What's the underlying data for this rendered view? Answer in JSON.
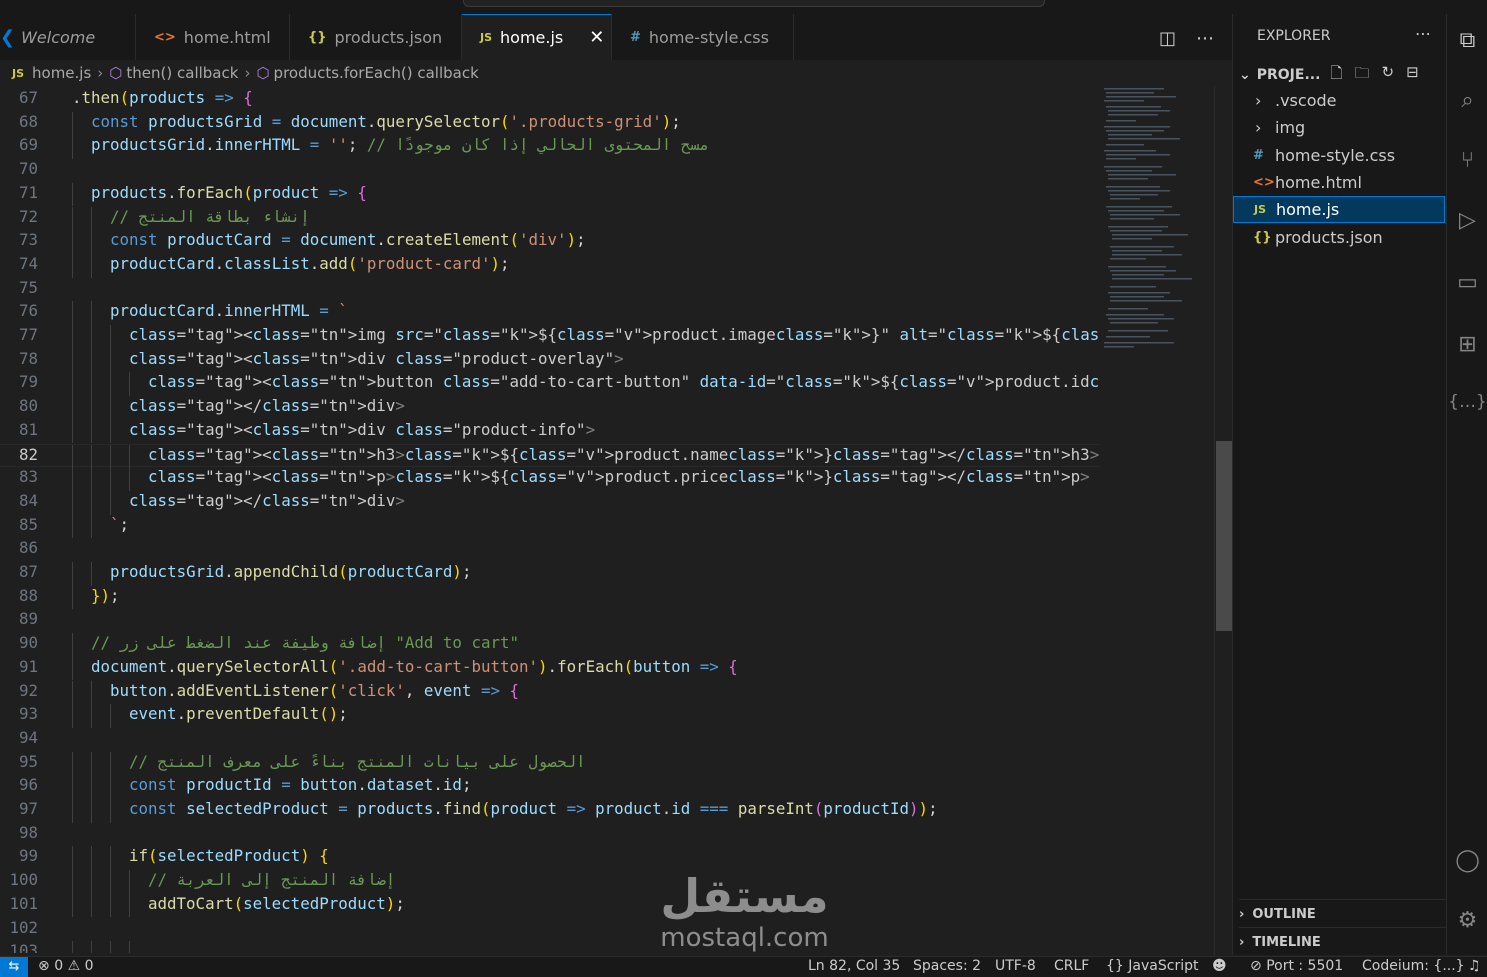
{
  "tabs": [
    {
      "label": "Welcome",
      "icon": "vscode-logo-icon"
    },
    {
      "label": "home.html",
      "icon": "html-file-icon"
    },
    {
      "label": "products.json",
      "icon": "json-file-icon"
    },
    {
      "label": "home.js",
      "icon": "js-file-icon",
      "active": true
    },
    {
      "label": "home-style.css",
      "icon": "css-file-icon"
    }
  ],
  "tab_icons": {
    "js": "JS",
    "json": "{}",
    "html": "<>",
    "css": "#"
  },
  "breadcrumb": [
    "home.js",
    "then() callback",
    "products.forEach() callback"
  ],
  "code_lines": [
    {
      "n": "67",
      "text": ".then(products => {"
    },
    {
      "n": "68",
      "text": "const productsGrid = document.querySelector('.products-grid');"
    },
    {
      "n": "69",
      "text": "productsGrid.innerHTML = ''; // مسح المحتوى الحالي إذا كان موجودًا"
    },
    {
      "n": "70",
      "text": ""
    },
    {
      "n": "71",
      "text": "products.forEach(product => {"
    },
    {
      "n": "72",
      "text": "// إنشاء بطاقة المنتج"
    },
    {
      "n": "73",
      "text": "const productCard = document.createElement('div');"
    },
    {
      "n": "74",
      "text": "productCard.classList.add('product-card');"
    },
    {
      "n": "75",
      "text": ""
    },
    {
      "n": "76",
      "text": "productCard.innerHTML = `"
    },
    {
      "n": "77",
      "text": "<img src=\"${product.image}\" alt=\"${product.alt}\">"
    },
    {
      "n": "78",
      "text": "<div class=\"product-overlay\">"
    },
    {
      "n": "79",
      "text": "<button class=\"add-to-cart-button\" data-id=\"${product.id}\">Add to cart</button>"
    },
    {
      "n": "80",
      "text": "</div>"
    },
    {
      "n": "81",
      "text": "<div class=\"product-info\">"
    },
    {
      "n": "82",
      "text": "<h3>${product.name}</h3>"
    },
    {
      "n": "83",
      "text": "<p>${product.price}</p>"
    },
    {
      "n": "84",
      "text": "</div>"
    },
    {
      "n": "85",
      "text": "`;"
    },
    {
      "n": "86",
      "text": ""
    },
    {
      "n": "87",
      "text": "productsGrid.appendChild(productCard);"
    },
    {
      "n": "88",
      "text": "});"
    },
    {
      "n": "89",
      "text": ""
    },
    {
      "n": "90",
      "text": "// إضافة وظيفة عند الضغط على زر \"Add to cart\""
    },
    {
      "n": "91",
      "text": "document.querySelectorAll('.add-to-cart-button').forEach(button => {"
    },
    {
      "n": "92",
      "text": "button.addEventListener('click', event => {"
    },
    {
      "n": "93",
      "text": "event.preventDefault();"
    },
    {
      "n": "94",
      "text": ""
    },
    {
      "n": "95",
      "text": "// الحصول على بيانات المنتج بناءً على معرف المنتج"
    },
    {
      "n": "96",
      "text": "const productId = button.dataset.id;"
    },
    {
      "n": "97",
      "text": "const selectedProduct = products.find(product => product.id === parseInt(productId));"
    },
    {
      "n": "98",
      "text": ""
    },
    {
      "n": "99",
      "text": "if (selectedProduct) {"
    },
    {
      "n": "100",
      "text": "// إضافة المنتج إلى العربة"
    },
    {
      "n": "101",
      "text": "addToCart(selectedProduct);"
    },
    {
      "n": "102",
      "text": ""
    },
    {
      "n": "103",
      "text": ""
    }
  ],
  "current_line": "82",
  "explorer": {
    "title": "EXPLORER",
    "project": "PROJE...",
    "items": [
      {
        "label": ".vscode",
        "type": "folder",
        "icon": "chevron-right-icon"
      },
      {
        "label": "img",
        "type": "folder",
        "icon": "chevron-right-icon"
      },
      {
        "label": "home-style.css",
        "type": "css",
        "icon": "css-file-icon"
      },
      {
        "label": "home.html",
        "type": "html",
        "icon": "html-file-icon"
      },
      {
        "label": "home.js",
        "type": "js",
        "icon": "js-file-icon",
        "selected": true
      },
      {
        "label": "products.json",
        "type": "json",
        "icon": "json-file-icon"
      }
    ],
    "outline": "OUTLINE",
    "timeline": "TIMELINE"
  },
  "status": {
    "errors": "0",
    "warnings": "0",
    "position": "Ln 82, Col 35",
    "spaces": "Spaces: 2",
    "encoding": "UTF-8",
    "eol": "CRLF",
    "language": "JavaScript",
    "port": "Port : 5501",
    "codeium": "Codeium: {...}"
  },
  "watermark": {
    "arabic": "مستقل",
    "latin": "mostaql.com"
  },
  "colors": {
    "accent": "#0078d4",
    "editor_bg": "#1f1f1f",
    "sidebar_bg": "#181818"
  }
}
